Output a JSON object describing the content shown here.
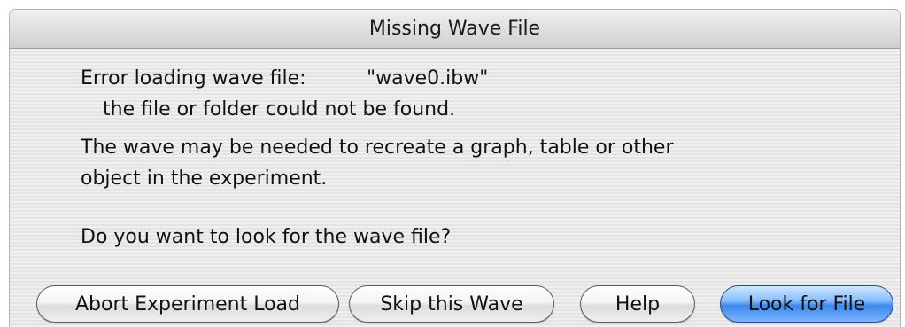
{
  "dialog": {
    "title": "Missing Wave File"
  },
  "message": {
    "error_label": "Error loading wave file:",
    "filename": "\"wave0.ibw\"",
    "not_found": "the file or folder could not be found.",
    "explanation_line1": "The wave may be needed to recreate a graph, table or other",
    "explanation_line2": "object in the experiment.",
    "question": "Do you want to look for the wave file?"
  },
  "buttons": {
    "abort": "Abort Experiment Load",
    "skip": "Skip this Wave",
    "help": "Help",
    "look": "Look for File"
  },
  "colors": {
    "default_button": "#3c88ec",
    "window_background": "#ececec"
  }
}
